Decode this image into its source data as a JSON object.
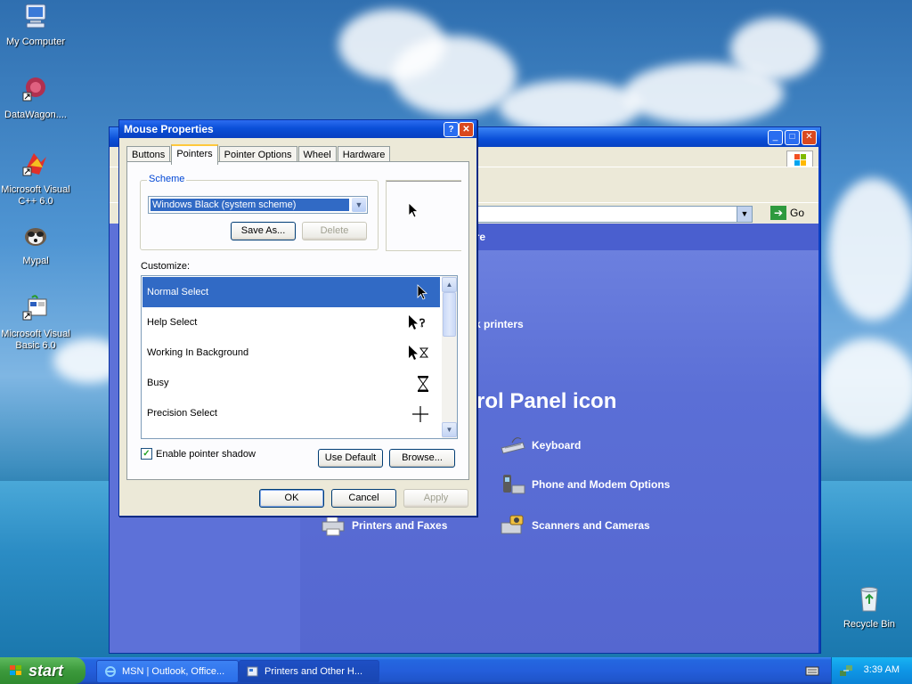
{
  "desktop": {
    "icons": [
      {
        "label": "My Computer"
      },
      {
        "label": "DataWagon...."
      },
      {
        "label": "Microsoft Visual C++ 6.0"
      },
      {
        "label": "Mypal"
      },
      {
        "label": "Microsoft Visual Basic 6.0"
      },
      {
        "label": "Recycle Bin"
      }
    ]
  },
  "control_panel": {
    "header_fragment": "are",
    "printers_link": "k printers",
    "pick_heading": "trol Panel icon",
    "go_label": "Go",
    "items": [
      {
        "label": "Keyboard",
        "icon": "keyboard-icon"
      },
      {
        "label": "Phone and Modem Options",
        "icon": "phone-icon"
      },
      {
        "label": "Printers and Faxes",
        "icon": "printer-icon"
      },
      {
        "label": "Scanners and Cameras",
        "icon": "scanner-icon"
      }
    ]
  },
  "dialog": {
    "title": "Mouse Properties",
    "help_glyph": "?",
    "close_glyph": "✕",
    "tabs": [
      "Buttons",
      "Pointers",
      "Pointer Options",
      "Wheel",
      "Hardware"
    ],
    "active_tab": "Pointers",
    "scheme": {
      "group_label": "Scheme",
      "selected": "Windows Black  (system scheme)",
      "save_as": "Save As...",
      "delete": "Delete"
    },
    "customize_label": "Customize:",
    "pointer_list": [
      {
        "label": "Normal Select",
        "cursor": "arrow",
        "selected": true
      },
      {
        "label": "Help Select",
        "cursor": "help"
      },
      {
        "label": "Working In Background",
        "cursor": "busy-arrow"
      },
      {
        "label": "Busy",
        "cursor": "hourglass"
      },
      {
        "label": "Precision Select",
        "cursor": "crosshair"
      }
    ],
    "enable_shadow_label": "Enable pointer shadow",
    "enable_shadow_checked": true,
    "use_default": "Use Default",
    "browse": "Browse...",
    "ok": "OK",
    "cancel": "Cancel",
    "apply": "Apply"
  },
  "taskbar": {
    "start_label": "start",
    "tasks": [
      {
        "label": "MSN | Outlook, Office...",
        "active": false
      },
      {
        "label": "Printers and Other H...",
        "active": true
      }
    ],
    "clock": "3:39 AM"
  },
  "colors": {
    "selection": "#316ac5",
    "title_blue": "#0a4fd8",
    "panel_bg": "#ece9d8",
    "start_green": "#3c9a3c"
  }
}
